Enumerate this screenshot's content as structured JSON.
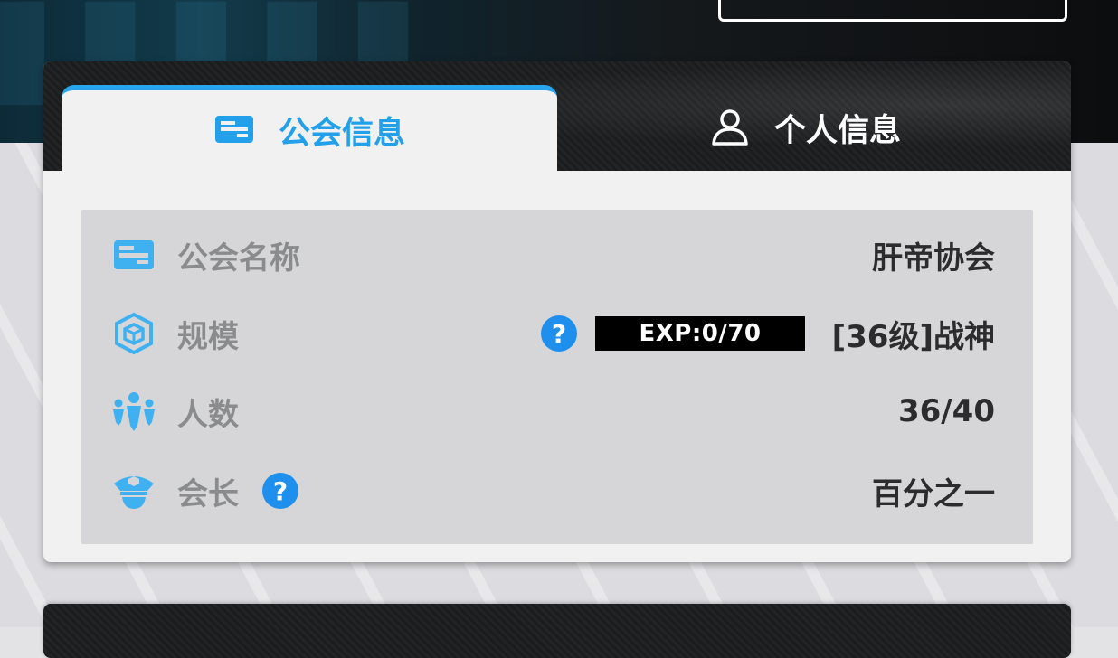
{
  "tabs": {
    "guild_info": {
      "label": "公会信息",
      "icon": "id-card-icon",
      "active": true
    },
    "personal_info": {
      "label": "个人信息",
      "icon": "user-icon",
      "active": false
    }
  },
  "guild": {
    "name": {
      "label": "公会名称",
      "value": "肝帝协会",
      "icon": "id-card-icon"
    },
    "scale": {
      "label": "规模",
      "value": "[36级]战神",
      "exp": "EXP:0/70",
      "help": "?",
      "icon": "cube-icon"
    },
    "members": {
      "label": "人数",
      "value": "36/40",
      "icon": "people-icon"
    },
    "leader": {
      "label": "会长",
      "value": "百分之一",
      "help": "?",
      "icon": "officer-cap-icon"
    }
  },
  "colors": {
    "accent": "#22a0ea",
    "help_badge": "#1e8fec",
    "label_gray": "#8a8b8d",
    "value_dark": "#2c2c2e",
    "header_dark": "#1b1c1e"
  }
}
